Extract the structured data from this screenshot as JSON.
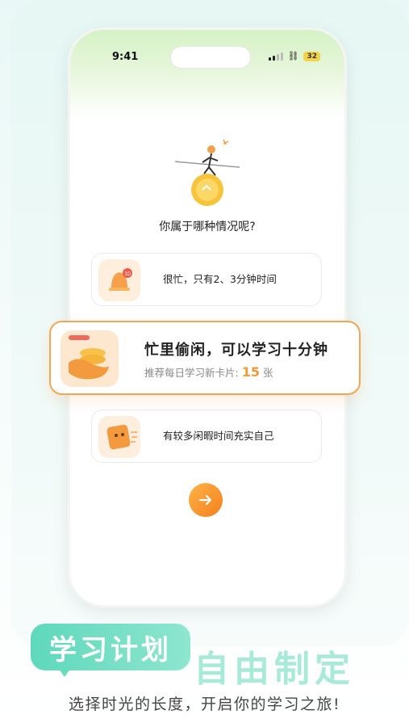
{
  "status_bar": {
    "time": "9:41",
    "battery": "32"
  },
  "question": "你属于哪种情况呢?",
  "options": [
    {
      "label": "很忙，只有2、3分钟时间"
    },
    {
      "title": "忙里偷闲，可以学习十分钟",
      "subtitle": "推荐每日学习新卡片:",
      "count": "15",
      "unit": "张"
    },
    {
      "label": "有较多闲暇时间充实自己"
    }
  ],
  "promo": {
    "tag": "学习计划",
    "headline": "自由制定",
    "subtitle": "选择时光的长度，开启你的学习之旅!"
  },
  "colors": {
    "accent": "#f19a36",
    "mint": "#5ed8bb"
  }
}
